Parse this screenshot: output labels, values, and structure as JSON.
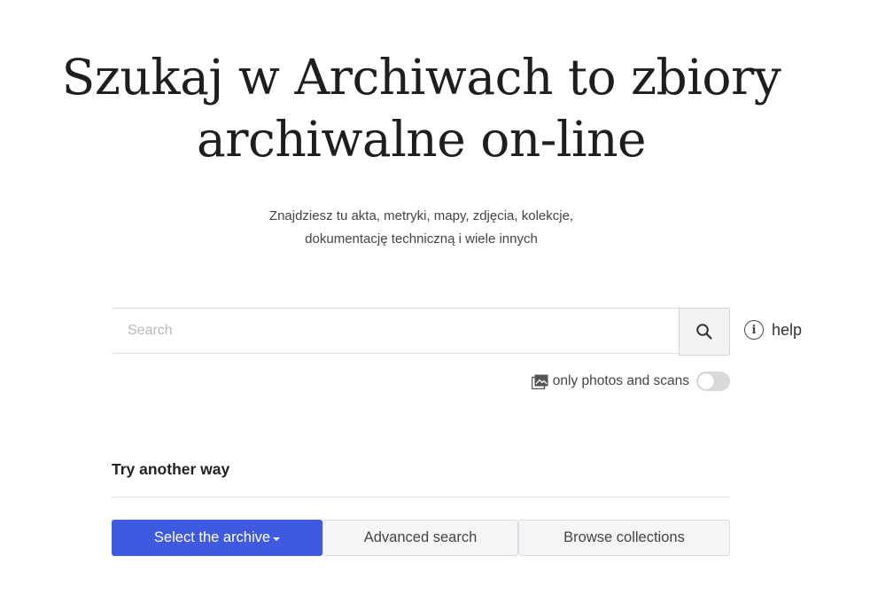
{
  "hero": {
    "title_line1": "Szukaj w Archiwach to zbiory",
    "title_line2": "archiwalne on-line",
    "subtitle_line1": "Znajdziesz tu akta, metryki, mapy, zdjęcia, kolekcje,",
    "subtitle_line2": "dokumentację techniczną i wiele innych"
  },
  "search": {
    "placeholder": "Search",
    "value": "",
    "button_icon": "search-icon"
  },
  "help": {
    "icon": "info-icon",
    "label": "help"
  },
  "filter": {
    "icon": "photo-gallery-icon",
    "label": "only photos and scans",
    "enabled": false
  },
  "alternatives": {
    "heading": "Try another way",
    "select_archive_label": "Select the archive",
    "advanced_search_label": "Advanced search",
    "browse_collections_label": "Browse collections"
  },
  "colors": {
    "primary": "#3f5ae0",
    "secondary_bg": "#f4f5f7",
    "toggle_off": "#dadada"
  }
}
